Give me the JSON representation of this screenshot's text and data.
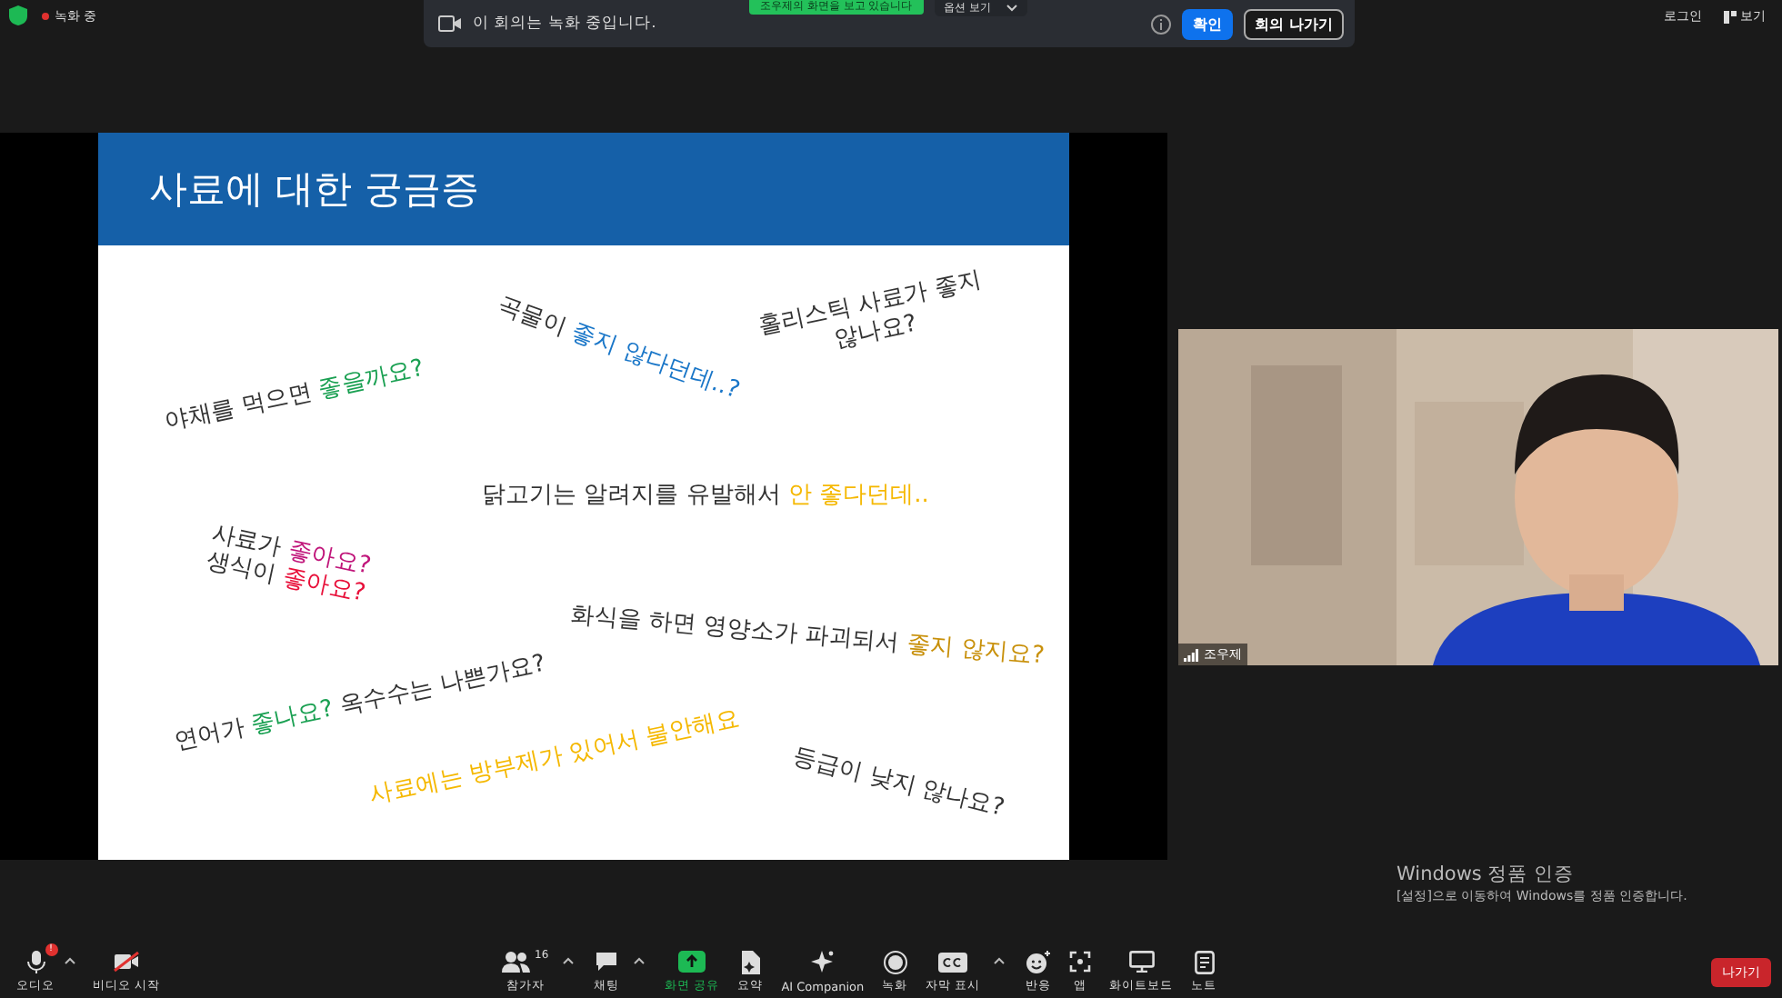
{
  "top_bar": {
    "recording": {
      "label": "녹화 중",
      "on": true
    },
    "right_buttons": [
      {
        "kind": "login",
        "label": "로그인"
      },
      {
        "kind": "view",
        "label": "보기"
      }
    ]
  },
  "banner": {
    "message": "이 회의는 녹화 중입니다.",
    "share_notice": "조우제의 화면을 보고 있습니다",
    "view_options": "옵션 보기",
    "buttons": [
      {
        "kind": "primary",
        "label": "확인"
      },
      {
        "kind": "outline",
        "label": "회의 나가기"
      }
    ]
  },
  "slide": {
    "title": "사료에 대한 궁금증",
    "notes": [
      {
        "lines": [
          [
            {
              "text": "야채를 먹으면 ",
              "color": "#333333"
            },
            {
              "text": "좋을까요?",
              "color": "#1aa052"
            }
          ]
        ]
      },
      {
        "lines": [
          [
            {
              "text": "곡물이 ",
              "color": "#333333"
            },
            {
              "text": "좋지 않다던데..?",
              "color": "#1976c8"
            }
          ]
        ]
      },
      {
        "lines": [
          [
            {
              "text": "홀리스틱 사료가 좋지",
              "color": "#333333"
            }
          ],
          [
            {
              "text": "않나요?",
              "color": "#333333"
            }
          ]
        ]
      },
      {
        "lines": [
          [
            {
              "text": "닭고기는 알려지를 유발해서 ",
              "color": "#333333"
            },
            {
              "text": "안 좋다던데..",
              "color": "#f5b800"
            }
          ]
        ]
      },
      {
        "lines": [
          [
            {
              "text": "사료가 ",
              "color": "#333333"
            },
            {
              "text": "좋아요?",
              "color": "#c0157a"
            }
          ]
        ]
      },
      {
        "lines": [
          [
            {
              "text": "생식이 ",
              "color": "#333333"
            },
            {
              "text": "좋아요?",
              "color": "#e8103a"
            }
          ]
        ]
      },
      {
        "lines": [
          [
            {
              "text": "화식을 하면 영양소가 파괴되서 ",
              "color": "#333333"
            },
            {
              "text": "좋지 않지요?",
              "color": "#c8900a"
            }
          ]
        ]
      },
      {
        "lines": [
          [
            {
              "text": "연어가 ",
              "color": "#333333"
            },
            {
              "text": "좋나요?",
              "color": "#1aa052"
            },
            {
              "text": " 옥수수는 나쁜가요?",
              "color": "#333333"
            }
          ]
        ]
      },
      {
        "lines": [
          [
            {
              "text": "사료에는 방부제가 있어서 불안해요",
              "color": "#f5b800"
            }
          ]
        ]
      },
      {
        "lines": [
          [
            {
              "text": "등급이 낮지 않나요?",
              "color": "#333333"
            }
          ]
        ]
      }
    ]
  },
  "video": {
    "kind": "picture",
    "participant": "조우제"
  },
  "activation": {
    "title": "Windows 정품 인증",
    "message": "[설정]으로 이동하여 Windows를 정품 인증합니다."
  },
  "toolbar": {
    "left": [
      {
        "kind": "audio",
        "label": "오디오",
        "badge": "!",
        "caret": true
      },
      {
        "kind": "video",
        "label": "비디오 시작",
        "caret": false
      }
    ],
    "center": [
      {
        "kind": "participants",
        "label": "참가자",
        "count": "16",
        "caret": true
      },
      {
        "kind": "chat",
        "label": "채팅",
        "caret": true
      },
      {
        "kind": "share",
        "label": "화면 공유",
        "caret": false
      },
      {
        "kind": "summary",
        "label": "요약",
        "caret": false
      },
      {
        "kind": "ai",
        "label": "AI Companion",
        "caret": false
      },
      {
        "kind": "record",
        "label": "녹화",
        "caret": false
      },
      {
        "kind": "captions",
        "label": "자막 표시",
        "caret": true
      },
      {
        "kind": "reactions",
        "label": "반응",
        "caret": false
      },
      {
        "kind": "apps",
        "label": "앱",
        "caret": false
      },
      {
        "kind": "whiteboard",
        "label": "화이트보드",
        "caret": false
      },
      {
        "kind": "notes",
        "label": "노트",
        "caret": false
      }
    ],
    "leave": "나가기"
  }
}
